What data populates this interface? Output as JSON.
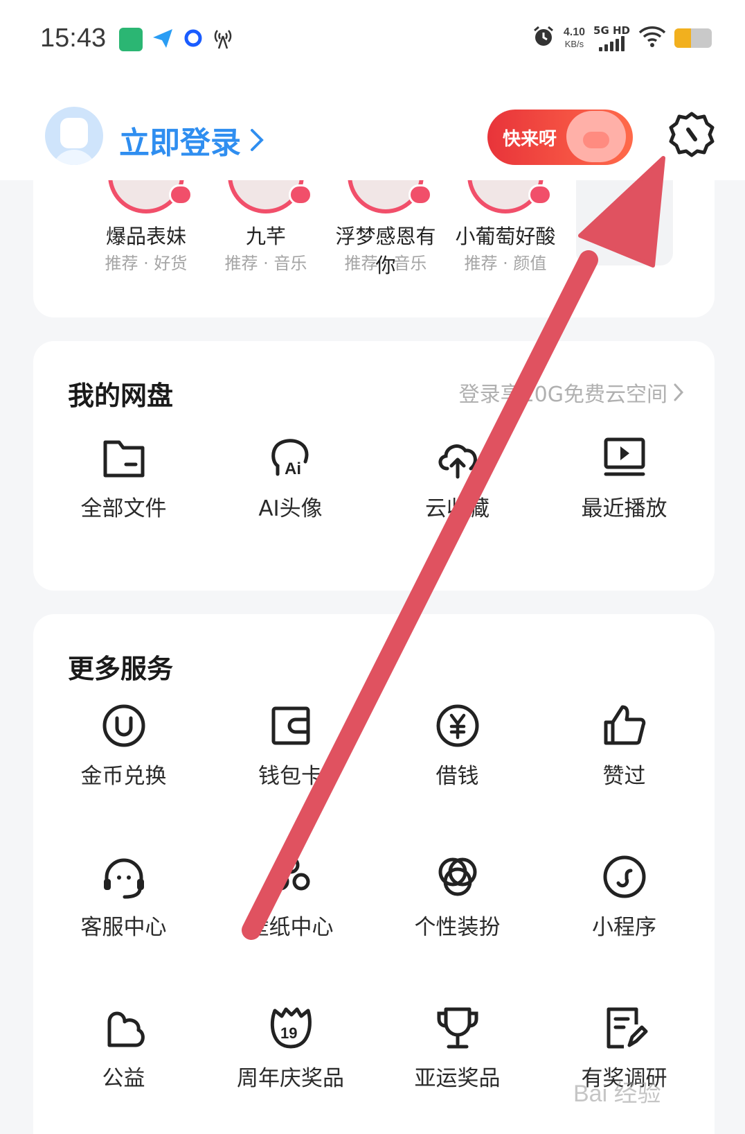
{
  "status_bar": {
    "time": "15:43",
    "net_speed_value": "4.10",
    "net_speed_unit": "KB/s",
    "signal_label": "5G HD",
    "battery_level": 0.45,
    "battery_color": "#f2b01e"
  },
  "header": {
    "login_label": "立即登录",
    "promo_label": "快来呀",
    "settings_icon": "gear-icon"
  },
  "creators": [
    {
      "name": "爆品表妹",
      "tags": "推荐 · 好货"
    },
    {
      "name": "九芊",
      "tags": "推荐 · 音乐"
    },
    {
      "name": "浮梦感恩有你",
      "tags": "推荐 · 音乐"
    },
    {
      "name": "小葡萄好酸",
      "tags": "推荐 · 颜值"
    }
  ],
  "netdisk": {
    "title": "我的网盘",
    "link": "登录享10G免费云空间",
    "items": [
      {
        "label": "全部文件",
        "icon": "folder-icon"
      },
      {
        "label": "AI头像",
        "icon": "ai-avatar-icon"
      },
      {
        "label": "云收藏",
        "icon": "cloud-upload-icon"
      },
      {
        "label": "最近播放",
        "icon": "video-play-icon"
      }
    ]
  },
  "services": {
    "title": "更多服务",
    "items": [
      {
        "label": "金币兑换",
        "icon": "coin-icon"
      },
      {
        "label": "钱包卡",
        "icon": "wallet-icon"
      },
      {
        "label": "借钱",
        "icon": "yuan-icon"
      },
      {
        "label": "赞过",
        "icon": "thumbs-up-icon"
      },
      {
        "label": "客服中心",
        "icon": "headset-icon"
      },
      {
        "label": "壁纸中心",
        "icon": "wallpaper-icon"
      },
      {
        "label": "个性装扮",
        "icon": "theme-icon"
      },
      {
        "label": "小程序",
        "icon": "mini-program-icon"
      },
      {
        "label": "公益",
        "icon": "charity-icon"
      },
      {
        "label": "周年庆奖品",
        "icon": "anniversary-icon"
      },
      {
        "label": "亚运奖品",
        "icon": "trophy-icon"
      },
      {
        "label": "有奖调研",
        "icon": "survey-icon"
      }
    ]
  },
  "colors": {
    "accent": "#2f8ef0",
    "arrow": "#e05260",
    "live_badge": "#f14f6a"
  },
  "watermark": "Bai 经验"
}
